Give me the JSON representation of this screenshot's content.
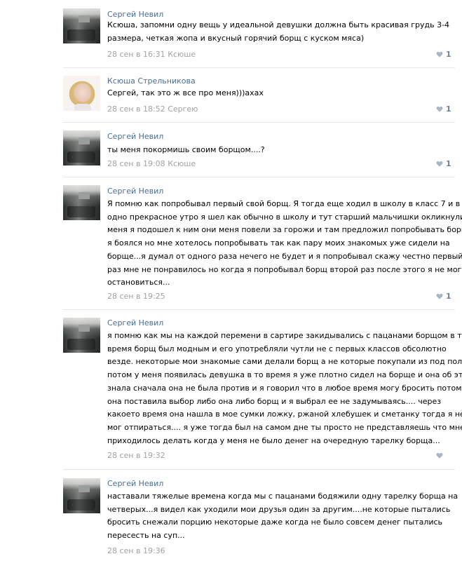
{
  "comments": [
    {
      "author": "Сергей Невил",
      "lines": [
        "Ксюша, запомни одну вещь у идеальной девушки должна быть красивая грудь 3-4",
        "размера, четкая жопа и вкусный горячий борщ с куском мяса)"
      ],
      "date": "28 сен в 16:31",
      "reply_to": "Ксюше",
      "likes": "1"
    },
    {
      "author": "Ксюша Стрельникова",
      "lines": [
        "Сергей, так это ж все про меня)))ахах"
      ],
      "date": "28 сен в 18:52",
      "reply_to": "Сергею",
      "likes": "1"
    },
    {
      "author": "Сергей Невил",
      "lines": [
        "ты меня покормишь своим борщом....?"
      ],
      "date": "28 сен в 19:08",
      "reply_to": "Ксюше",
      "likes": "1"
    },
    {
      "author": "Сергей Невил",
      "lines": [
        "Я помню как попробывал первый свой борщ. Я тогда еще ходил в школу в класс 7 и в",
        "одно прекрасное утро я шел как обычно в школу и тут старший мальчишки окликнули",
        "меня я подошел к ним они меня повели за горожи и там предложил попробывать борщ...",
        "я боялся но мне хотелось попробывать так как пару моих знакомых уже сидели на",
        "борще...я думал от одного раза нечего не будет и я попробывал скажу честно первый",
        "раз мне не понравилось но когда я попробывал борщ второй раз после этого я не мог",
        "остановиться..."
      ],
      "date": "28 сен в 19:25",
      "reply_to": "",
      "likes": "1"
    },
    {
      "author": "Сергей Невил",
      "lines": [
        "я помню как мы на каждой перемени в сартире закидывались с пацанами борщом в то",
        "время борщ был модным и его употребляли чутли не с первых классов обсолютно",
        "везде. некоторые мои знакомые сами делали борщ а не которые покупали из под полы.",
        "потом у меня появилась девушка в то время я уже плотно сидел на борще и она об этом",
        "знала сначала она не была против и я говорил что в любое время могу бросить потом",
        "она поставила выбор либо она либо борщ и я выбрал ее не задумываясь.... через",
        "какоето время она нашла в мое сумки ложку, ржаной хлебушек и сметанку тогда я не",
        "мог отпираться.... я уже тогда был на самом дне ты просто не представляешь что мне",
        "приходилось делать когда у меня не было денег на очередную тарелку борща..."
      ],
      "date": "28 сен в 19:32",
      "reply_to": "",
      "likes": ""
    },
    {
      "author": "Сергей Невил",
      "lines": [
        "наставали тяжелые времена когда мы с пацанами бодяжили одну тарелку борща на",
        "четверых...я видел как уходили мои друзья один за другим....не которые пытались",
        "бросить снежали порцию некоторые даже когда не было совсем денег пытались",
        "пересесть на суп..."
      ],
      "date": "28 сен в 19:36",
      "reply_to": "",
      "likes": ""
    }
  ],
  "colors": {
    "author": "#4a6d94",
    "meta": "#a1a1a1",
    "like_icon": "#a7b7c8",
    "divider": "#e4e7ea"
  },
  "icons": {
    "like": "heart-icon",
    "avatar": "user-photo"
  }
}
